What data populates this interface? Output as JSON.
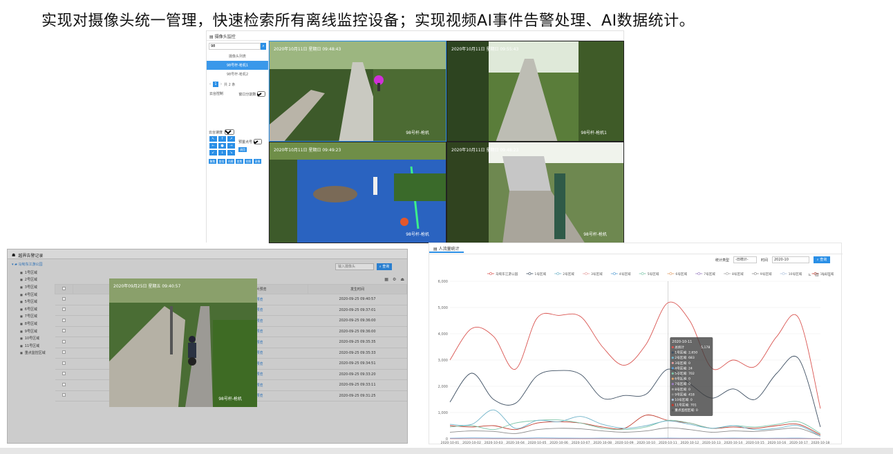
{
  "headline": "实现对摄像头统一管理，快速检索所有离线监控设备；实现视频AI事件告警处理、AI数据统计。",
  "camera_panel": {
    "title": "摄像头监控",
    "search_value": "98",
    "list_title": "摄像头列表",
    "cameras": [
      "98号杆-枪机1",
      "98号杆-枪机2"
    ],
    "pager": {
      "page": "1",
      "total": "共 2 条"
    },
    "ptz_label": "云台控制",
    "window_label": "窗口分割数",
    "window_value": "2x2",
    "speed_label": "云台速度",
    "speed_value": "4",
    "preset_label": "预置点号",
    "preset_button": "调用",
    "ptz_buttons": [
      "↖",
      "↑",
      "↗",
      "←",
      "●",
      "→",
      "↙",
      "↓",
      "↘"
    ],
    "action_buttons": [
      "聚焦",
      "变倍",
      "光圈",
      "变焦",
      "拍照",
      "录像"
    ],
    "videos": [
      {
        "timestamp": "2020年10月11日 星期日 09:48:43",
        "label": "98号杆-枪机"
      },
      {
        "timestamp": "2020年10月11日 星期日 09:55:43",
        "label": "98号杆-枪机1"
      },
      {
        "timestamp": "2020年10月11日 星期日 09:49:23",
        "label": "98号杆-枪机"
      },
      {
        "timestamp": "2020年10月11日 星期日 09:48:23",
        "label": "98号杆-枪机"
      }
    ]
  },
  "alarm_panel": {
    "title": "越界告警记录",
    "tree_root": "马甸东江游公园",
    "tree_items": [
      "1号区域",
      "2号区域",
      "3号区域",
      "4号区域",
      "5号区域",
      "6号区域",
      "7号区域",
      "8号区域",
      "9号区域",
      "10号区域",
      "11号区域",
      "重点监控区域"
    ],
    "search_placeholder": "输入摄像头",
    "search_button": "查询",
    "tool_icons": [
      "grid-icon",
      "settings-icon",
      "export-icon"
    ],
    "columns": [
      "",
      "上报时间",
      "图片预览",
      "发生时间"
    ],
    "rows": [
      {
        "camera": "98号杆",
        "preview": "预览",
        "time": "2020-09-25 09:40:57"
      },
      {
        "camera": "98号杆",
        "preview": "预览",
        "time": "2020-09-25 09:37:01"
      },
      {
        "camera": "98号杆",
        "preview": "预览",
        "time": "2020-09-25 09:36:00"
      },
      {
        "camera": "98号杆",
        "preview": "预览",
        "time": "2020-09-25 09:36:00"
      },
      {
        "camera": "98号杆",
        "preview": "预览",
        "time": "2020-09-25 09:35:35"
      },
      {
        "camera": "98号杆",
        "preview": "预览",
        "time": "2020-09-25 09:35:33"
      },
      {
        "camera": "98号杆",
        "preview": "预览",
        "time": "2020-09-25 09:34:51"
      },
      {
        "camera": "98号杆",
        "preview": "预览",
        "time": "2020-09-25 09:33:20"
      },
      {
        "camera": "98号杆",
        "preview": "预览",
        "time": "2020-09-25 09:33:11"
      },
      {
        "camera": "98号杆",
        "preview": "预览",
        "time": "2020-09-25 09:31:25"
      }
    ],
    "popup_timestamp": "2020年09月25日 星期五 09:40:57",
    "popup_label": "98号杆-枪机"
  },
  "flow_panel": {
    "tab": "人流量统计",
    "stat_type_label": "统计类型",
    "stat_type_value": "-日统计-",
    "time_label": "时间",
    "time_value": "2020-10",
    "query_button": "查询",
    "tooltip": {
      "title": "2020-10-11",
      "lines": [
        {
          "name": "总统计",
          "value": "5,178"
        },
        {
          "name": "1号区域",
          "value": "2,650"
        },
        {
          "name": "2号区域",
          "value": "683"
        },
        {
          "name": "3号区域",
          "value": "0"
        },
        {
          "name": "4号区域",
          "value": "24"
        },
        {
          "name": "5号区域",
          "value": "702"
        },
        {
          "name": "6号区域",
          "value": "0"
        },
        {
          "name": "7号区域",
          "value": "0"
        },
        {
          "name": "8号区域",
          "value": "0"
        },
        {
          "name": "9号区域",
          "value": "418"
        },
        {
          "name": "10号区域",
          "value": "0"
        },
        {
          "name": "11号区域",
          "value": "701"
        },
        {
          "name": "重点监控区域",
          "value": "0"
        }
      ]
    }
  },
  "chart_data": {
    "type": "line",
    "title": "",
    "xlabel": "",
    "ylabel": "",
    "ylim": [
      0,
      6000
    ],
    "yticks": [
      "0",
      "1,000",
      "2,000",
      "3,000",
      "4,000",
      "5,000",
      "6,000"
    ],
    "grid": true,
    "legend_position": "top",
    "x": [
      "2020-10-01",
      "2020-10-02",
      "2020-10-03",
      "2020-10-04",
      "2020-10-05",
      "2020-10-06",
      "2020-10-07",
      "2020-10-08",
      "2020-10-09",
      "2020-10-10",
      "2020-10-11",
      "2020-10-12",
      "2020-10-13",
      "2020-10-14",
      "2020-10-15",
      "2020-10-16",
      "2020-10-17",
      "2020-10-18"
    ],
    "series": [
      {
        "name": "马甸东江游公园",
        "color": "#d9534f",
        "values": [
          3000,
          4200,
          3900,
          2650,
          4600,
          4700,
          4650,
          3500,
          2800,
          3600,
          5178,
          4500,
          2700,
          3000,
          2750,
          3900,
          4600,
          1150
        ]
      },
      {
        "name": "1号区域",
        "color": "#3e4f62",
        "values": [
          1400,
          2500,
          1500,
          1350,
          2400,
          2600,
          2450,
          1550,
          1650,
          1700,
          2650,
          2100,
          1550,
          1900,
          1500,
          2500,
          3050,
          450
        ]
      },
      {
        "name": "2号区域",
        "color": "#6fb3c9",
        "values": [
          550,
          550,
          1100,
          400,
          700,
          650,
          850,
          550,
          400,
          500,
          683,
          550,
          400,
          500,
          350,
          400,
          500,
          100
        ]
      },
      {
        "name": "3号区域",
        "color": "#e6a0a0",
        "values": [
          0,
          0,
          0,
          0,
          0,
          0,
          0,
          0,
          0,
          0,
          0,
          0,
          0,
          0,
          0,
          0,
          0,
          0
        ]
      },
      {
        "name": "4号区域",
        "color": "#5aa0d6",
        "values": [
          20,
          30,
          25,
          20,
          30,
          25,
          20,
          25,
          20,
          20,
          24,
          20,
          20,
          25,
          20,
          20,
          25,
          10
        ]
      },
      {
        "name": "5号区域",
        "color": "#7cc5a8",
        "values": [
          450,
          500,
          350,
          600,
          700,
          720,
          600,
          400,
          350,
          450,
          702,
          600,
          400,
          500,
          450,
          550,
          650,
          200
        ]
      },
      {
        "name": "6号区域",
        "color": "#e4a36c",
        "values": [
          0,
          0,
          0,
          0,
          0,
          0,
          0,
          0,
          0,
          0,
          0,
          0,
          0,
          0,
          0,
          0,
          0,
          0
        ]
      },
      {
        "name": "7号区域",
        "color": "#9a7dc1",
        "values": [
          0,
          0,
          0,
          0,
          0,
          0,
          0,
          0,
          0,
          0,
          0,
          0,
          0,
          0,
          0,
          0,
          0,
          0
        ]
      },
      {
        "name": "8号区域",
        "color": "#a6a6a6",
        "values": [
          0,
          0,
          0,
          0,
          0,
          0,
          0,
          0,
          0,
          0,
          0,
          0,
          0,
          0,
          0,
          0,
          0,
          0
        ]
      },
      {
        "name": "9号区域",
        "color": "#8c8c8c",
        "values": [
          250,
          300,
          280,
          200,
          350,
          400,
          380,
          300,
          250,
          300,
          418,
          350,
          250,
          300,
          280,
          350,
          400,
          100
        ]
      },
      {
        "name": "10号区域",
        "color": "#b0c4de",
        "values": [
          0,
          0,
          0,
          0,
          0,
          0,
          0,
          0,
          0,
          0,
          0,
          0,
          0,
          0,
          0,
          0,
          0,
          0
        ]
      },
      {
        "name": "11号区域",
        "color": "#c0392b",
        "values": [
          500,
          450,
          500,
          350,
          600,
          650,
          600,
          450,
          400,
          900,
          701,
          600,
          400,
          450,
          400,
          500,
          550,
          150
        ]
      },
      {
        "name": "重点监控区域",
        "color": "#555555",
        "values": [
          0,
          0,
          0,
          0,
          0,
          0,
          0,
          0,
          0,
          0,
          0,
          0,
          0,
          0,
          0,
          0,
          0,
          0
        ]
      }
    ]
  }
}
